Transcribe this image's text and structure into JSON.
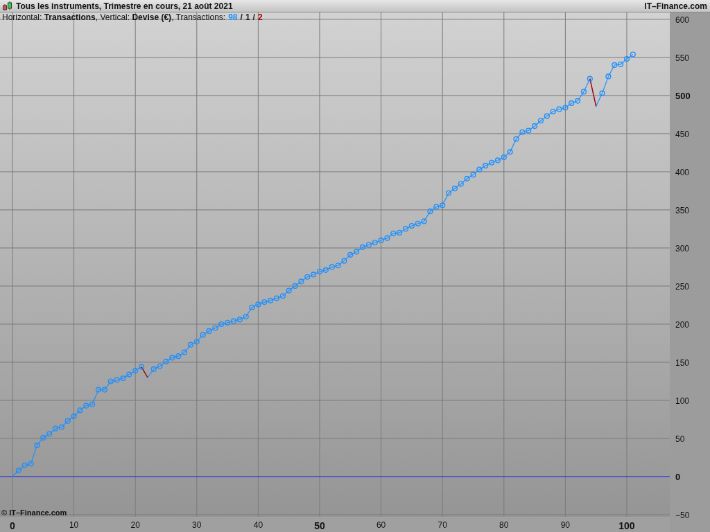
{
  "window": {
    "title": "Tous les instruments, Trimestre en cours, 21 août 2021",
    "brand": "IT–Finance.com"
  },
  "subtitle": {
    "text": "Horizontal: **Transactions**, Vertical: **Devise (€)**, Transactions:",
    "counts": [
      {
        "text": "98",
        "color": "#1e90ff"
      },
      {
        "text": "/",
        "color": "#222222"
      },
      {
        "text": "1",
        "color": "#222222"
      },
      {
        "text": "/",
        "color": "#222222"
      },
      {
        "text": "2",
        "color": "#b00000"
      }
    ]
  },
  "chart": {
    "chart_data": {
      "type": "line",
      "xlim": [
        -2.03,
        107
      ],
      "ylim": [
        -52.7,
        609
      ],
      "xticks": [
        {
          "value": 0,
          "label": "0"
        },
        {
          "value": 10,
          "label": "10"
        },
        {
          "value": 20,
          "label": "20"
        },
        {
          "value": 30,
          "label": "30"
        },
        {
          "value": 40,
          "label": "40"
        },
        {
          "value": 50,
          "label": "50"
        },
        {
          "value": 60,
          "label": "60"
        },
        {
          "value": 70,
          "label": "70"
        },
        {
          "value": 80,
          "label": "80"
        },
        {
          "value": 90,
          "label": "90"
        },
        {
          "value": 100,
          "label": "100"
        }
      ],
      "yticks": [
        {
          "value": -50,
          "label": "−50"
        },
        {
          "value": 0,
          "label": "0"
        },
        {
          "value": 50,
          "label": "50"
        },
        {
          "value": 100,
          "label": "100"
        },
        {
          "value": 150,
          "label": "150"
        },
        {
          "value": 200,
          "label": "200"
        },
        {
          "value": 250,
          "label": "250"
        },
        {
          "value": 300,
          "label": "300"
        },
        {
          "value": 350,
          "label": "350"
        },
        {
          "value": 400,
          "label": "400"
        },
        {
          "value": 450,
          "label": "450"
        },
        {
          "value": 500,
          "label": "500"
        },
        {
          "value": 550,
          "label": "550"
        },
        {
          "value": 600,
          "label": "600"
        }
      ],
      "grid": true,
      "ref_lines": [
        {
          "axis": "y",
          "value": 0,
          "color": "#2a2aff"
        }
      ],
      "x": [
        0,
        1,
        2,
        3,
        4,
        5,
        6,
        7,
        8,
        9,
        10,
        11,
        12,
        13,
        14,
        15,
        16,
        17,
        18,
        19,
        20,
        21,
        22,
        23,
        24,
        25,
        26,
        27,
        28,
        29,
        30,
        31,
        32,
        33,
        34,
        35,
        36,
        37,
        38,
        39,
        40,
        41,
        42,
        43,
        44,
        45,
        46,
        47,
        48,
        49,
        50,
        51,
        52,
        53,
        54,
        55,
        56,
        57,
        58,
        59,
        60,
        61,
        62,
        63,
        64,
        65,
        66,
        67,
        68,
        69,
        70,
        71,
        72,
        73,
        74,
        75,
        76,
        77,
        78,
        79,
        80,
        81,
        82,
        83,
        84,
        85,
        86,
        87,
        88,
        89,
        90,
        91,
        92,
        93,
        94,
        95,
        96,
        97,
        98,
        99,
        100,
        101
      ],
      "series": [
        {
          "color": "#1e90ff",
          "marker": "o",
          "values": [
            0,
            8,
            15,
            17,
            41,
            51,
            56,
            63,
            65,
            73,
            79,
            87,
            93,
            95,
            114,
            114,
            125,
            127,
            129,
            134,
            139,
            144,
            130,
            141,
            145,
            151,
            156,
            158,
            163,
            173,
            177,
            186,
            191,
            195,
            200,
            202,
            204,
            206,
            210,
            222,
            226,
            229,
            231,
            234,
            237,
            244,
            250,
            256,
            262,
            265,
            269,
            271,
            275,
            277,
            283,
            291,
            295,
            301,
            304,
            307,
            310,
            313,
            319,
            320,
            325,
            329,
            332,
            335,
            348,
            354,
            356,
            372,
            378,
            384,
            391,
            396,
            403,
            408,
            412,
            415,
            419,
            426,
            443,
            452,
            454,
            460,
            467,
            473,
            479,
            482,
            484,
            490,
            493,
            505,
            522,
            486,
            503,
            525,
            540,
            541,
            548,
            554
          ]
        }
      ]
    }
  },
  "copyright": "© IT–Finance.com"
}
